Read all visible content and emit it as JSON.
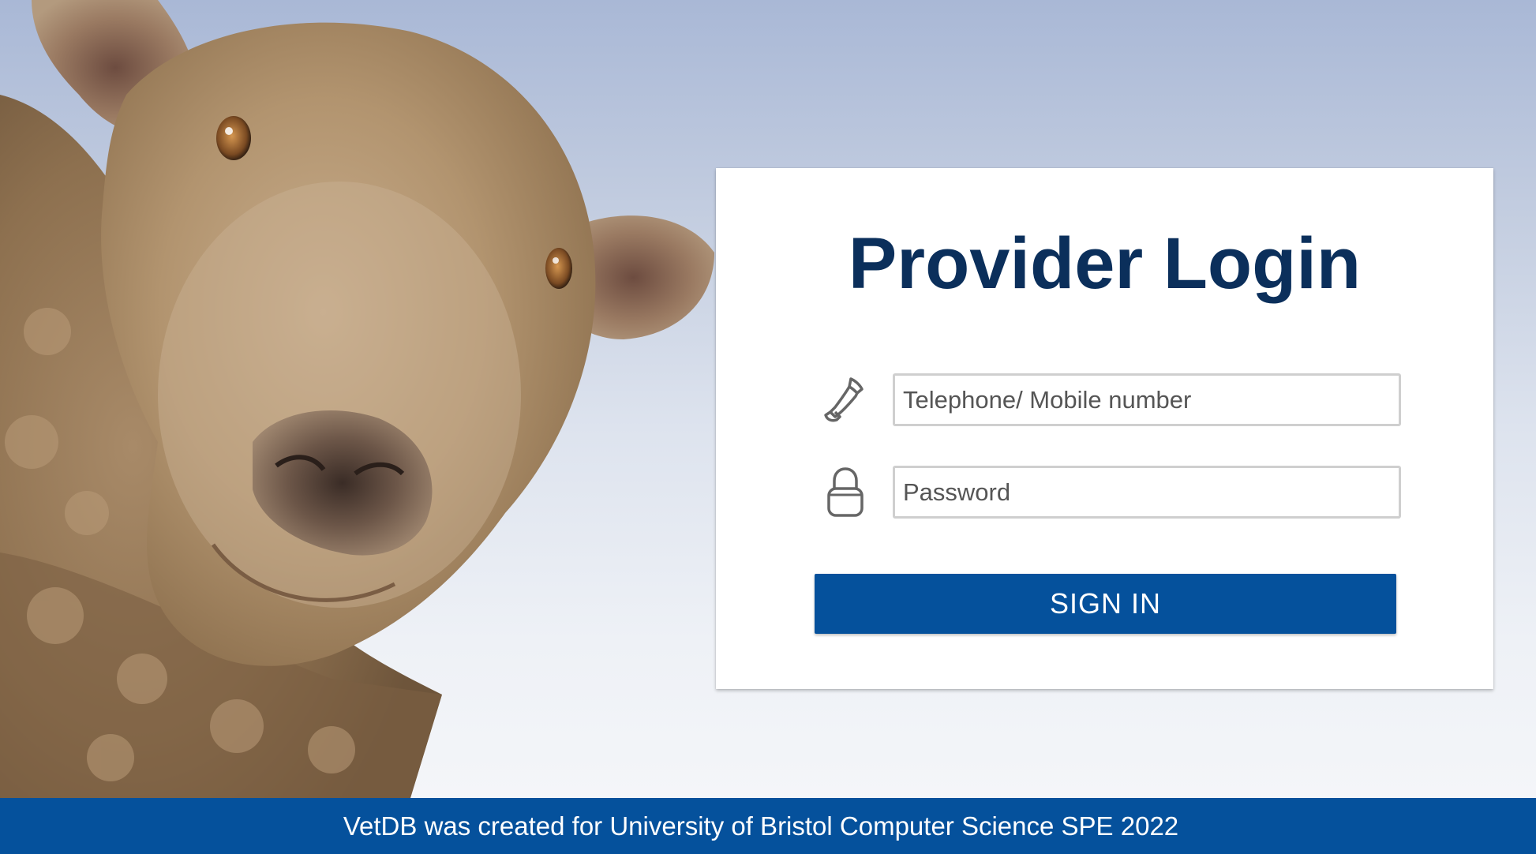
{
  "login": {
    "title": "Provider Login",
    "phone_icon": "phone-icon",
    "phone_placeholder": "Telephone/ Mobile number",
    "phone_value": "",
    "password_icon": "lock-icon",
    "password_placeholder": "Password",
    "password_value": "",
    "sign_in_label": "SIGN IN"
  },
  "footer": {
    "text": "VetDB was created for University of Bristol Computer Science SPE 2022"
  },
  "background": {
    "subject": "sheep-photo",
    "sky_color": "#b4c2dc"
  },
  "colors": {
    "title": "#0b2f5b",
    "primary": "#05519c",
    "input_border": "#cfcfcf",
    "icon": "#666666"
  }
}
